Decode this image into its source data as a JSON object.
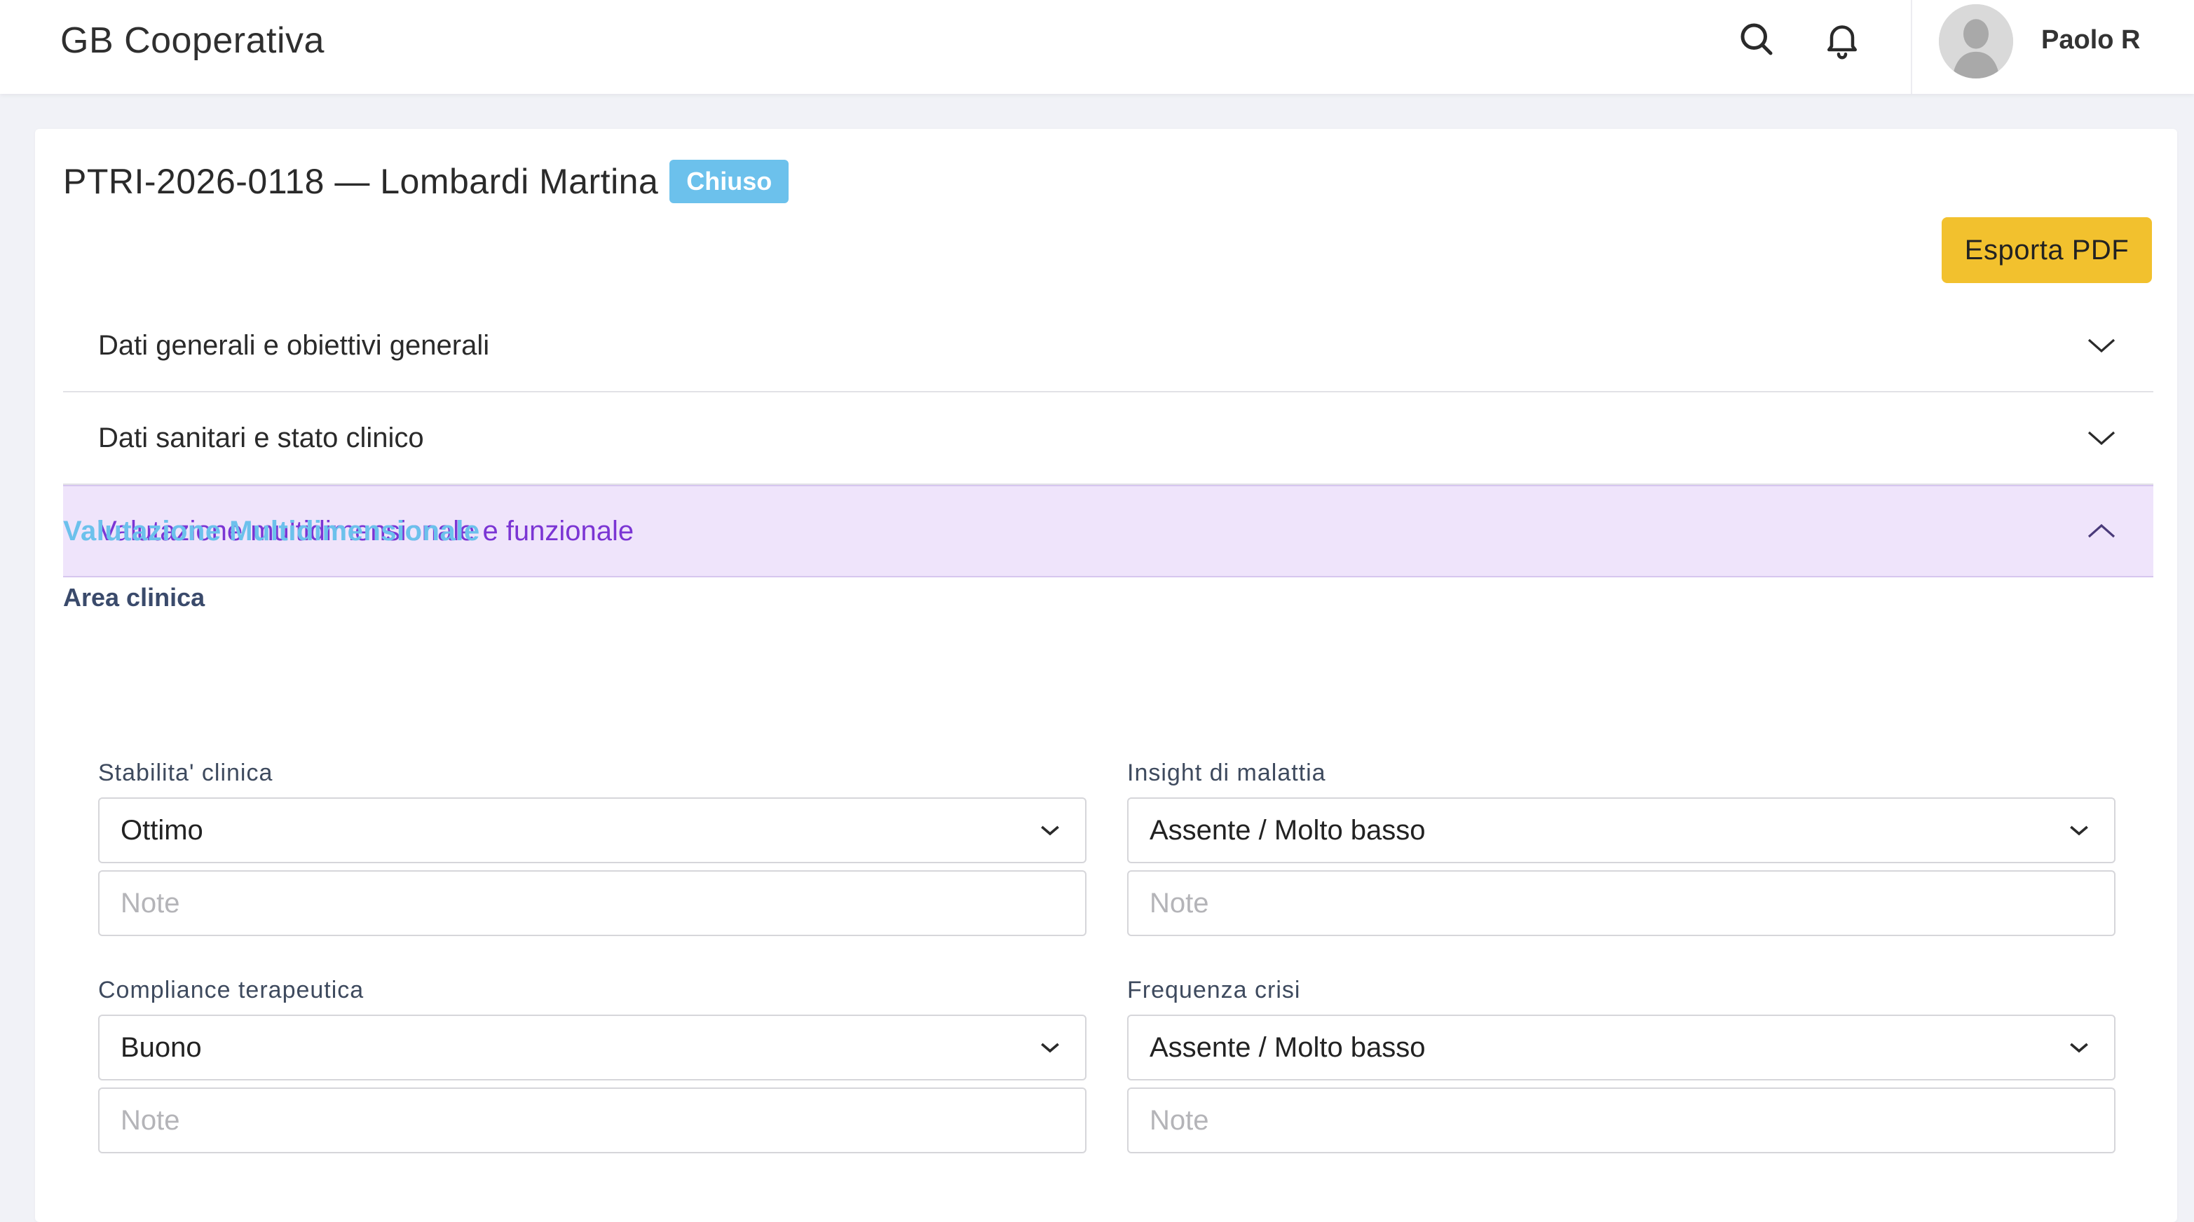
{
  "header": {
    "brand": "GB Cooperativa",
    "user_name": "Paolo R"
  },
  "page": {
    "title": "PTRI-2026-0118 — Lombardi Martina",
    "status": "Chiuso",
    "export_label": "Esporta PDF"
  },
  "accordion": {
    "items": [
      {
        "label": "Dati generali e obiettivi generali",
        "expanded": false
      },
      {
        "label": "Dati sanitari e stato clinico",
        "expanded": false
      },
      {
        "label": "Valutazione multidimensionale e funzionale",
        "expanded": true
      }
    ]
  },
  "section": {
    "title": "Valutazione Multidimensionale",
    "subsection": "Area clinica",
    "fields": [
      {
        "label": "Stabilita' clinica",
        "value": "Ottimo",
        "note_placeholder": "Note"
      },
      {
        "label": "Insight di malattia",
        "value": "Assente / Molto basso",
        "note_placeholder": "Note"
      },
      {
        "label": "Compliance terapeutica",
        "value": "Buono",
        "note_placeholder": "Note"
      },
      {
        "label": "Frequenza crisi",
        "value": "Assente / Molto basso",
        "note_placeholder": "Note"
      }
    ]
  },
  "colors": {
    "accent": "#6cc1ec",
    "active_section_bg": "#efe4fb",
    "active_section_text": "#7b35d4",
    "export_button": "#f2c12e"
  }
}
